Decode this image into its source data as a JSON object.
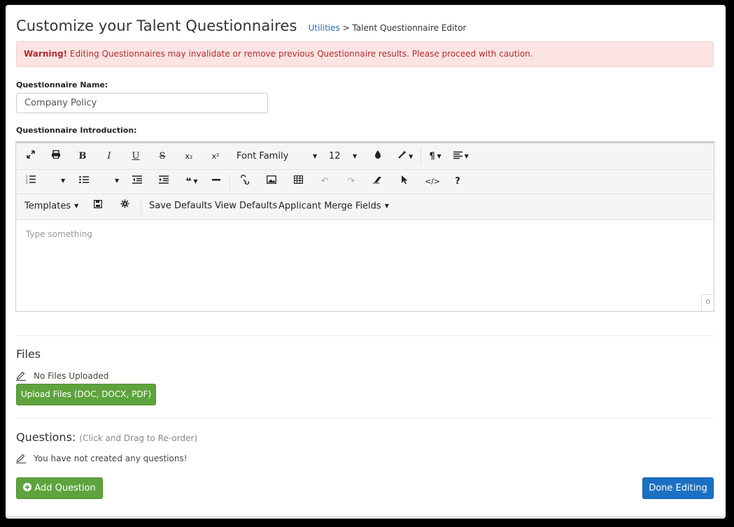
{
  "header": {
    "title": "Customize your Talent Questionnaires",
    "breadcrumb_link": "Utilities",
    "breadcrumb_sep": ">",
    "breadcrumb_current": "Talent Questionnaire Editor"
  },
  "warning": {
    "strong": "Warning!",
    "text": "Editing Questionnaires may invalidate or remove previous Questionnaire results. Please proceed with caution."
  },
  "form": {
    "name_label": "Questionnaire Name:",
    "name_value": "Company Policy",
    "intro_label": "Questionnaire Introduction:"
  },
  "editor": {
    "toolbar": {
      "bold": "B",
      "italic": "I",
      "underline": "U",
      "strikethrough": "S",
      "subscript": "x₂",
      "superscript": "x²",
      "font_family": "Font Family",
      "font_size": "12",
      "templates": "Templates",
      "save_defaults": "Save Defaults",
      "view_defaults": "View Defaults",
      "merge_fields": "Applicant Merge Fields",
      "help": "?"
    },
    "placeholder": "Type something",
    "counter": "0"
  },
  "files": {
    "title": "Files",
    "empty_text": "No Files Uploaded",
    "upload_label": "Upload Files (DOC, DOCX, PDF)"
  },
  "questions": {
    "title": "Questions:",
    "hint": "(Click and Drag to Re-order)",
    "empty_text": "You have not created any questions!",
    "add_label": "Add Question",
    "done_label": "Done Editing"
  },
  "colors": {
    "green": "#5ea33d",
    "blue": "#1a71c3",
    "warning_bg": "#fde4e4",
    "warning_text": "#b52b2b"
  }
}
